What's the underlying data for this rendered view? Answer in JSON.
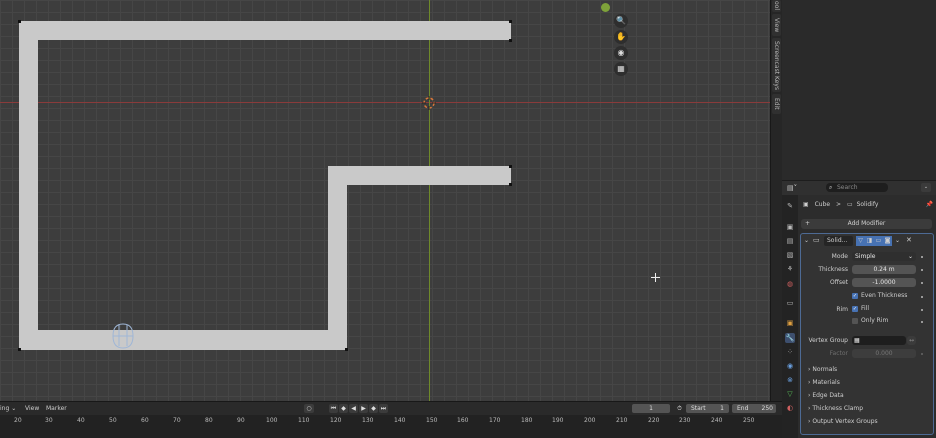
{
  "viewport": {
    "nav_icons": [
      "zoom-icon",
      "hand-pan-icon",
      "camera-icon",
      "grid-ortho-icon"
    ],
    "axis_colors": {
      "x": "#8a3b3b",
      "y": "#6f8a2a"
    }
  },
  "side_tabs": [
    "ool",
    "View",
    "Screencast Keys",
    "Edit"
  ],
  "properties": {
    "search_placeholder": "Search",
    "breadcrumb": {
      "object": "Cube",
      "separator": ">",
      "modifier": "Solidify"
    },
    "add_modifier": "Add Modifier",
    "modifier_name": "Solid...",
    "mode": {
      "label": "Mode",
      "value": "Simple"
    },
    "thickness": {
      "label": "Thickness",
      "value": "0.24 m"
    },
    "offset": {
      "label": "Offset",
      "value": "-1.0000"
    },
    "even_thickness": {
      "label": "Even Thickness",
      "checked": true
    },
    "rim": {
      "label": "Rim",
      "fill_label": "Fill",
      "only_rim_label": "Only Rim"
    },
    "vertex_group": {
      "label": "Vertex Group",
      "value": ""
    },
    "factor": {
      "label": "Factor",
      "value": "0.000"
    },
    "panels": [
      "Normals",
      "Materials",
      "Edge Data",
      "Thickness Clamp",
      "Output Vertex Groups"
    ]
  },
  "timeline": {
    "menu": [
      "ing",
      "View",
      "Marker"
    ],
    "current_frame": "1",
    "start_label": "Start",
    "start": "1",
    "end_label": "End",
    "end": "250",
    "ticks": [
      "20",
      "30",
      "40",
      "50",
      "60",
      "70",
      "80",
      "90",
      "100",
      "110",
      "120",
      "130",
      "140",
      "150",
      "160",
      "170",
      "180",
      "190",
      "200",
      "210",
      "220",
      "230",
      "240",
      "250"
    ]
  }
}
